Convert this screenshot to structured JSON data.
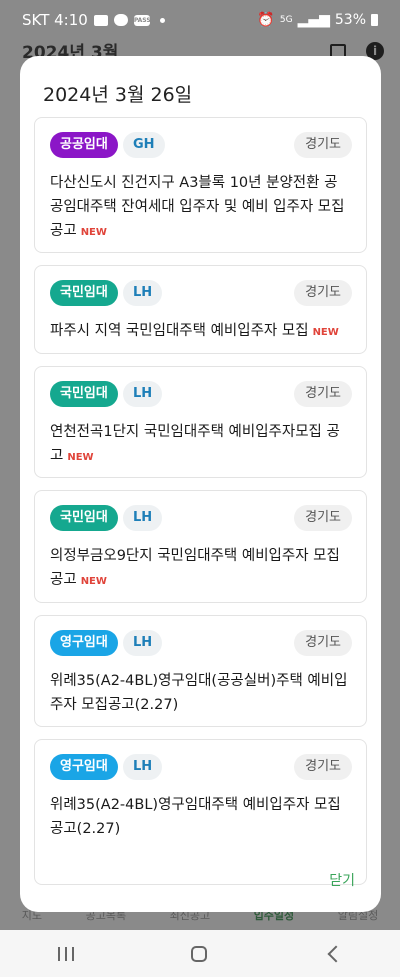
{
  "status_bar": {
    "carrier_time": "SKT 4:10",
    "signal": "5G",
    "battery": "53%"
  },
  "background": {
    "title": "2024년 3월",
    "info_symbol": "i",
    "tabs": [
      "지도",
      "공고목록",
      "최신공고",
      "입주일정",
      "알림설정"
    ]
  },
  "dialog": {
    "title": "2024년 3월 26일",
    "close_label": "닫기",
    "cards": [
      {
        "type": "공공임대",
        "type_color": "#8b16c7",
        "org": "GH",
        "region": "경기도",
        "title": "다산신도시 진건지구 A3블록 10년 분양전환 공공임대주택 잔여세대 입주자 및 예비 입주자 모집공고",
        "badge": "NEW"
      },
      {
        "type": "국민임대",
        "type_color": "#15a88f",
        "org": "LH",
        "region": "경기도",
        "title": "파주시 지역 국민임대주택 예비입주자 모집",
        "badge": "NEW"
      },
      {
        "type": "국민임대",
        "type_color": "#15a88f",
        "org": "LH",
        "region": "경기도",
        "title": "연천전곡1단지 국민임대주택 예비입주자모집 공고",
        "badge": "NEW"
      },
      {
        "type": "국민임대",
        "type_color": "#15a88f",
        "org": "LH",
        "region": "경기도",
        "title": "의정부금오9단지 국민임대주택 예비입주자 모집공고",
        "badge": "NEW"
      },
      {
        "type": "영구임대",
        "type_color": "#1aa5e6",
        "org": "LH",
        "region": "경기도",
        "title": "위례35(A2-4BL)영구임대(공공실버)주택 예비입주자 모집공고(2.27)",
        "badge": ""
      },
      {
        "type": "영구임대",
        "type_color": "#1aa5e6",
        "org": "LH",
        "region": "경기도",
        "title": "위례35(A2-4BL)영구임대주택 예비입주자 모집공고(2.27)",
        "badge": ""
      }
    ]
  }
}
